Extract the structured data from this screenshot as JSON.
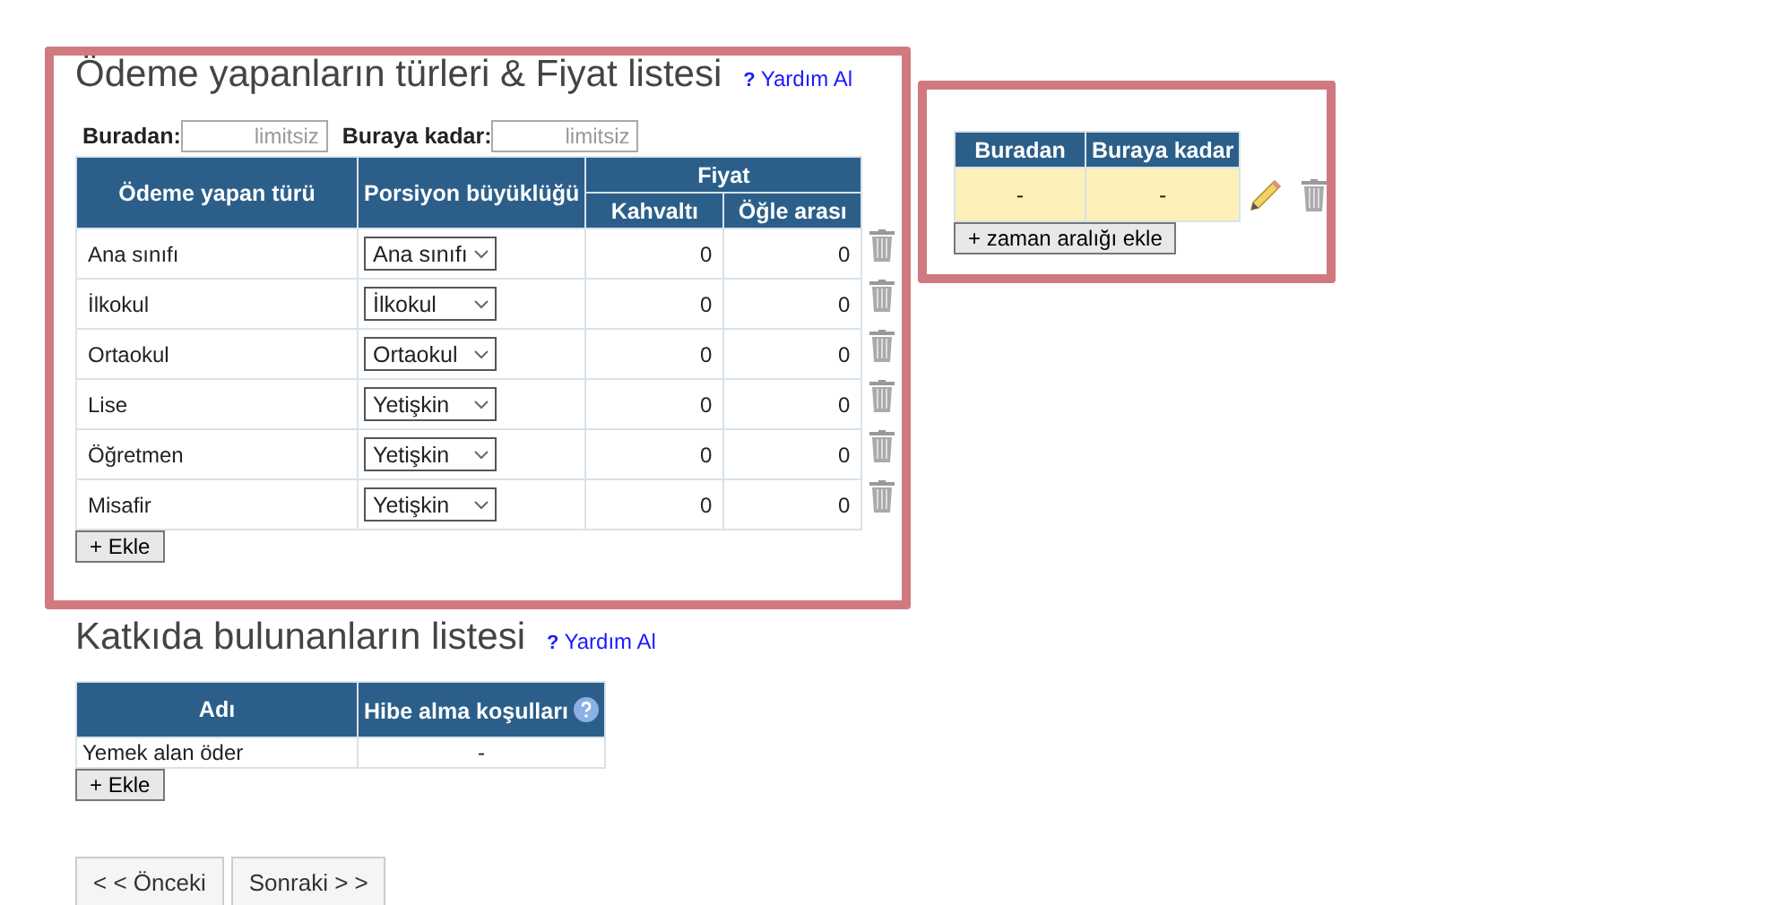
{
  "payers_section": {
    "title": "Ödeme yapanların türleri & Fiyat listesi",
    "help_link": "Yardım Al",
    "help_mark": "?",
    "filters": [
      {
        "label": "Buradan:",
        "placeholder": "limitsiz"
      },
      {
        "label": "Buraya kadar:",
        "placeholder": "limitsiz"
      }
    ],
    "table": {
      "columns": [
        "Ödeme yapan türü",
        "Porsiyon büyüklüğü"
      ],
      "group_column": "Fiyat",
      "sub_columns": [
        "Kahvaltı",
        "Öğle arası"
      ],
      "rows": [
        {
          "payer": "Ana sınıfı",
          "portion": "Ana sınıfı",
          "breakfast": "0",
          "lunch": "0"
        },
        {
          "payer": "İlkokul",
          "portion": "İlkokul",
          "breakfast": "0",
          "lunch": "0"
        },
        {
          "payer": "Ortaokul",
          "portion": "Ortaokul",
          "breakfast": "0",
          "lunch": "0"
        },
        {
          "payer": "Lise",
          "portion": "Yetişkin",
          "breakfast": "0",
          "lunch": "0"
        },
        {
          "payer": "Öğretmen",
          "portion": "Yetişkin",
          "breakfast": "0",
          "lunch": "0"
        },
        {
          "payer": "Misafir",
          "portion": "Yetişkin",
          "breakfast": "0",
          "lunch": "0"
        }
      ]
    },
    "add_button": "+ Ekle"
  },
  "time_range_panel": {
    "columns": [
      "Buradan",
      "Buraya kadar"
    ],
    "rows": [
      {
        "from": "-",
        "to": "-"
      }
    ],
    "add_button": "+ zaman aralığı ekle"
  },
  "contributors_section": {
    "title": "Katkıda bulunanların listesi",
    "help_link": "Yardım Al",
    "help_mark": "?",
    "table": {
      "columns": [
        "Adı",
        "Hibe alma koşulları"
      ],
      "rows": [
        {
          "name": "Yemek alan öder",
          "condition": "-"
        }
      ]
    },
    "add_button": "+ Ekle"
  },
  "navigation": {
    "buttons": [
      "< < Önceki",
      "Sonraki > >"
    ]
  }
}
